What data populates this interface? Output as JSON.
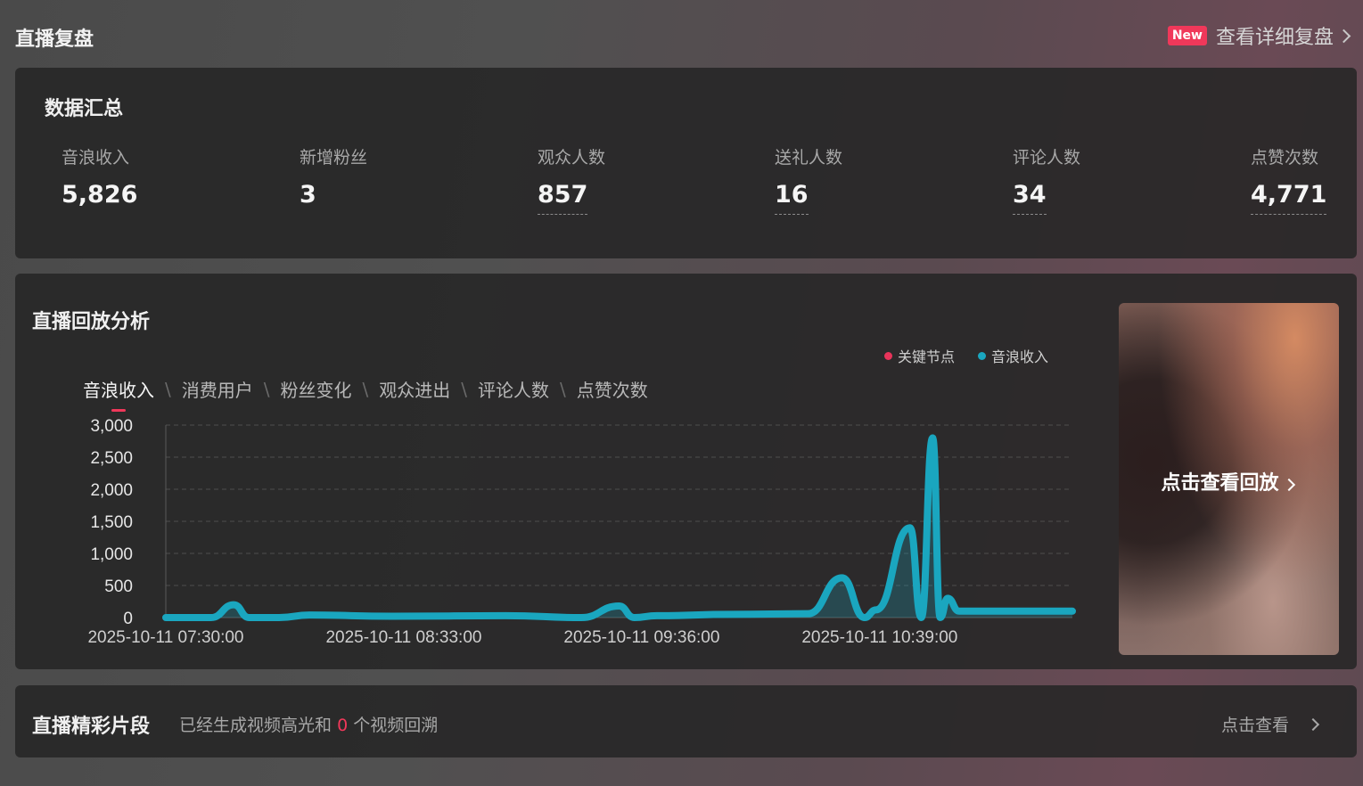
{
  "header": {
    "title": "直播复盘",
    "new_badge": "New",
    "detail_link": "查看详细复盘"
  },
  "summary": {
    "title": "数据汇总",
    "stats": [
      {
        "label": "音浪收入",
        "value": "5,826"
      },
      {
        "label": "新增粉丝",
        "value": "3"
      },
      {
        "label": "观众人数",
        "value": "857"
      },
      {
        "label": "送礼人数",
        "value": "16"
      },
      {
        "label": "评论人数",
        "value": "34"
      },
      {
        "label": "点赞次数",
        "value": "4,771"
      }
    ]
  },
  "replay": {
    "title": "直播回放分析",
    "legend": [
      {
        "label": "关键节点",
        "color": "#e8345a"
      },
      {
        "label": "音浪收入",
        "color": "#1aa6bf"
      }
    ],
    "tabs": [
      "音浪收入",
      "消费用户",
      "粉丝变化",
      "观众进出",
      "评论人数",
      "点赞次数"
    ],
    "active_tab": "音浪收入",
    "thumbnail_label": "点击查看回放"
  },
  "chart_data": {
    "type": "line",
    "series": [
      {
        "name": "音浪收入",
        "color": "#1aa6bf"
      }
    ],
    "x": [
      "2025-10-11 07:30:00",
      "2025-10-11 07:42:00",
      "2025-10-11 07:48:00",
      "2025-10-11 07:52:00",
      "2025-10-11 08:00:00",
      "2025-10-11 08:08:00",
      "2025-10-11 08:30:00",
      "2025-10-11 09:00:00",
      "2025-10-11 09:20:00",
      "2025-10-11 09:30:00",
      "2025-10-11 09:34:00",
      "2025-10-11 09:40:00",
      "2025-10-11 10:00:00",
      "2025-10-11 10:20:00",
      "2025-10-11 10:29:00",
      "2025-10-11 10:35:00",
      "2025-10-11 10:38:00",
      "2025-10-11 10:47:00",
      "2025-10-11 10:50:00",
      "2025-10-11 10:53:00",
      "2025-10-11 10:55:00",
      "2025-10-11 10:57:00",
      "2025-10-11 11:00:00",
      "2025-10-11 11:30:00"
    ],
    "values": [
      0,
      0,
      200,
      0,
      0,
      40,
      20,
      30,
      0,
      180,
      0,
      30,
      50,
      60,
      620,
      0,
      120,
      1400,
      0,
      2800,
      0,
      300,
      100,
      100
    ],
    "yticks": [
      "3,000",
      "2,500",
      "2,000",
      "1,500",
      "1,000",
      "500",
      "0"
    ],
    "xticks": [
      "2025-10-11 07:30:00",
      "2025-10-11 08:33:00",
      "2025-10-11 09:36:00",
      "2025-10-11 10:39:00"
    ],
    "ylim": [
      0,
      3000
    ],
    "grid": true
  },
  "highlights": {
    "title": "直播精彩片段",
    "desc_prefix": "已经生成视频高光和",
    "count": "0",
    "desc_suffix": "个视频回溯",
    "link": "点击查看"
  }
}
